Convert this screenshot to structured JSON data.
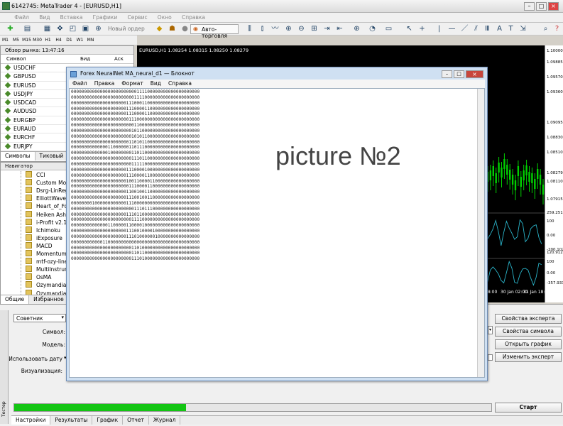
{
  "window": {
    "title": "6142745: MetaTrader 4 - [EURUSD,H1]"
  },
  "menu": [
    "Файл",
    "Вид",
    "Вставка",
    "Графики",
    "Сервис",
    "Окно",
    "Справка"
  ],
  "toolbar": {
    "new_order": "Новый ордер",
    "auto_trading": "Авто-торговля"
  },
  "timeframes": [
    "M1",
    "M5",
    "M15",
    "M30",
    "H1",
    "H4",
    "D1",
    "W1",
    "MN"
  ],
  "market_watch": {
    "header": "Обзор рынка: 13:47:16",
    "col_symbol": "Символ",
    "col_bid": "Бид",
    "col_ask": "Аск",
    "symbols": [
      "USDCHF",
      "GBPUSD",
      "EURUSD",
      "USDJPY",
      "USDCAD",
      "AUDUSD",
      "EURGBP",
      "EURAUD",
      "EURCHF",
      "EURJPY"
    ],
    "tabs": [
      "Символы",
      "Тиковый"
    ]
  },
  "navigator": {
    "header": "Навигатор",
    "items": [
      "CCI",
      "Custom Mov",
      "Dsrg-LinReg",
      "ElliottWaveP",
      "Heart_of_Fore",
      "Heiken Ashi",
      "i-Profit v2.1",
      "Ichimoku",
      "iExposure",
      "MACD",
      "Momentum",
      "mtf-ozy-line",
      "MultiInstrum",
      "OsMA",
      "Ozymandias",
      "Ozymandias"
    ],
    "tabs": [
      "Общие",
      "Избранное"
    ]
  },
  "chart": {
    "info": "EURUSD,H1  1.08254 1.08315 1.08250 1.08279",
    "price_labels": [
      "1.10000",
      "1.09885",
      "1.09570",
      "1.09360",
      "1.09095",
      "1.08830",
      "1.08510",
      "1.08279",
      "1.08110",
      "1.07915",
      "259.2518",
      "100",
      "0.00",
      "-200.1024",
      "120.9127",
      "100",
      "0.00",
      "-357.933"
    ],
    "time_labels": [
      "28:00",
      "30 Jan 02:00",
      "31 Jan 18:00"
    ],
    "green": "#00d000"
  },
  "tester": {
    "type": "Советник",
    "labels": {
      "symbol": "Символ:",
      "model": "Модель:",
      "use_date": "Использовать дату",
      "visual": "Визуализация:"
    },
    "buttons": [
      "Свойства эксперта",
      "Свойства символа",
      "Открыть график",
      "Изменить эксперт"
    ],
    "start": "Старт",
    "progress_fraction": 0.36,
    "tabs": [
      "Настройки",
      "Результаты",
      "График",
      "Отчет",
      "Журнал"
    ],
    "side_label": "Тестер"
  },
  "notepad": {
    "title": "Forex NeuralNet MA_neural_d1 — Блокнот",
    "menu": [
      "Файл",
      "Правка",
      "Формат",
      "Вид",
      "Справка"
    ],
    "lines": [
      "0000000000000000000000000111100000000000000000000",
      "0000000000000000000000001111000000000000000000000",
      "0000000000000000000001110001100000000000000000000",
      "0000000000000000000001110000110000000000000000000",
      "0000000000000000000001110000110000000000000000000",
      "0000000000000000000000111000000000000000000000000",
      "0000000000000000000000001100000000000000000000000",
      "0000000000000000000000010110000000000000000000000",
      "0000000000000000000000010101100000000000000000000",
      "0000000000000000000000110101100000000000000000000",
      "0000000000000011000000110111000000000000000000000",
      "0000000000000010000000011011000000000000000000000",
      "0000000000000000000000011101100000000000000000000",
      "0000000000000000000000011111000000000000000000000",
      "0000000000000000000001110000100000000000000000000",
      "0000000000000000000001110000110000000000000000000",
      "0000000000000000000001001100001100000000000000000",
      "0000000000000000000000111000011000000000000000000",
      "0000000000000000000001100100110000000000000000000",
      "0000000000000000000001110010011000000000000000000",
      "0000000010000000000001110000000000000000000000000",
      "0000000000000000000000001110111000000000000000000",
      "0000000000000000000001110110000000000000000000000",
      "0000000000000000000000011110000000000000000000000",
      "0000000000000011000001100001000000000000000000000",
      "0000000000000000000001110010000100000000000000000",
      "0000000000000000000001110100000010000000000000000",
      "0000000000001100000000000000000000000000000000000",
      "0000000000000000000000011010000000000000000000000",
      "0000000000000000000000011011000000000000000000000",
      "0000000000000000000000011101000000000000000000000"
    ]
  },
  "picture_label": "picture №2"
}
